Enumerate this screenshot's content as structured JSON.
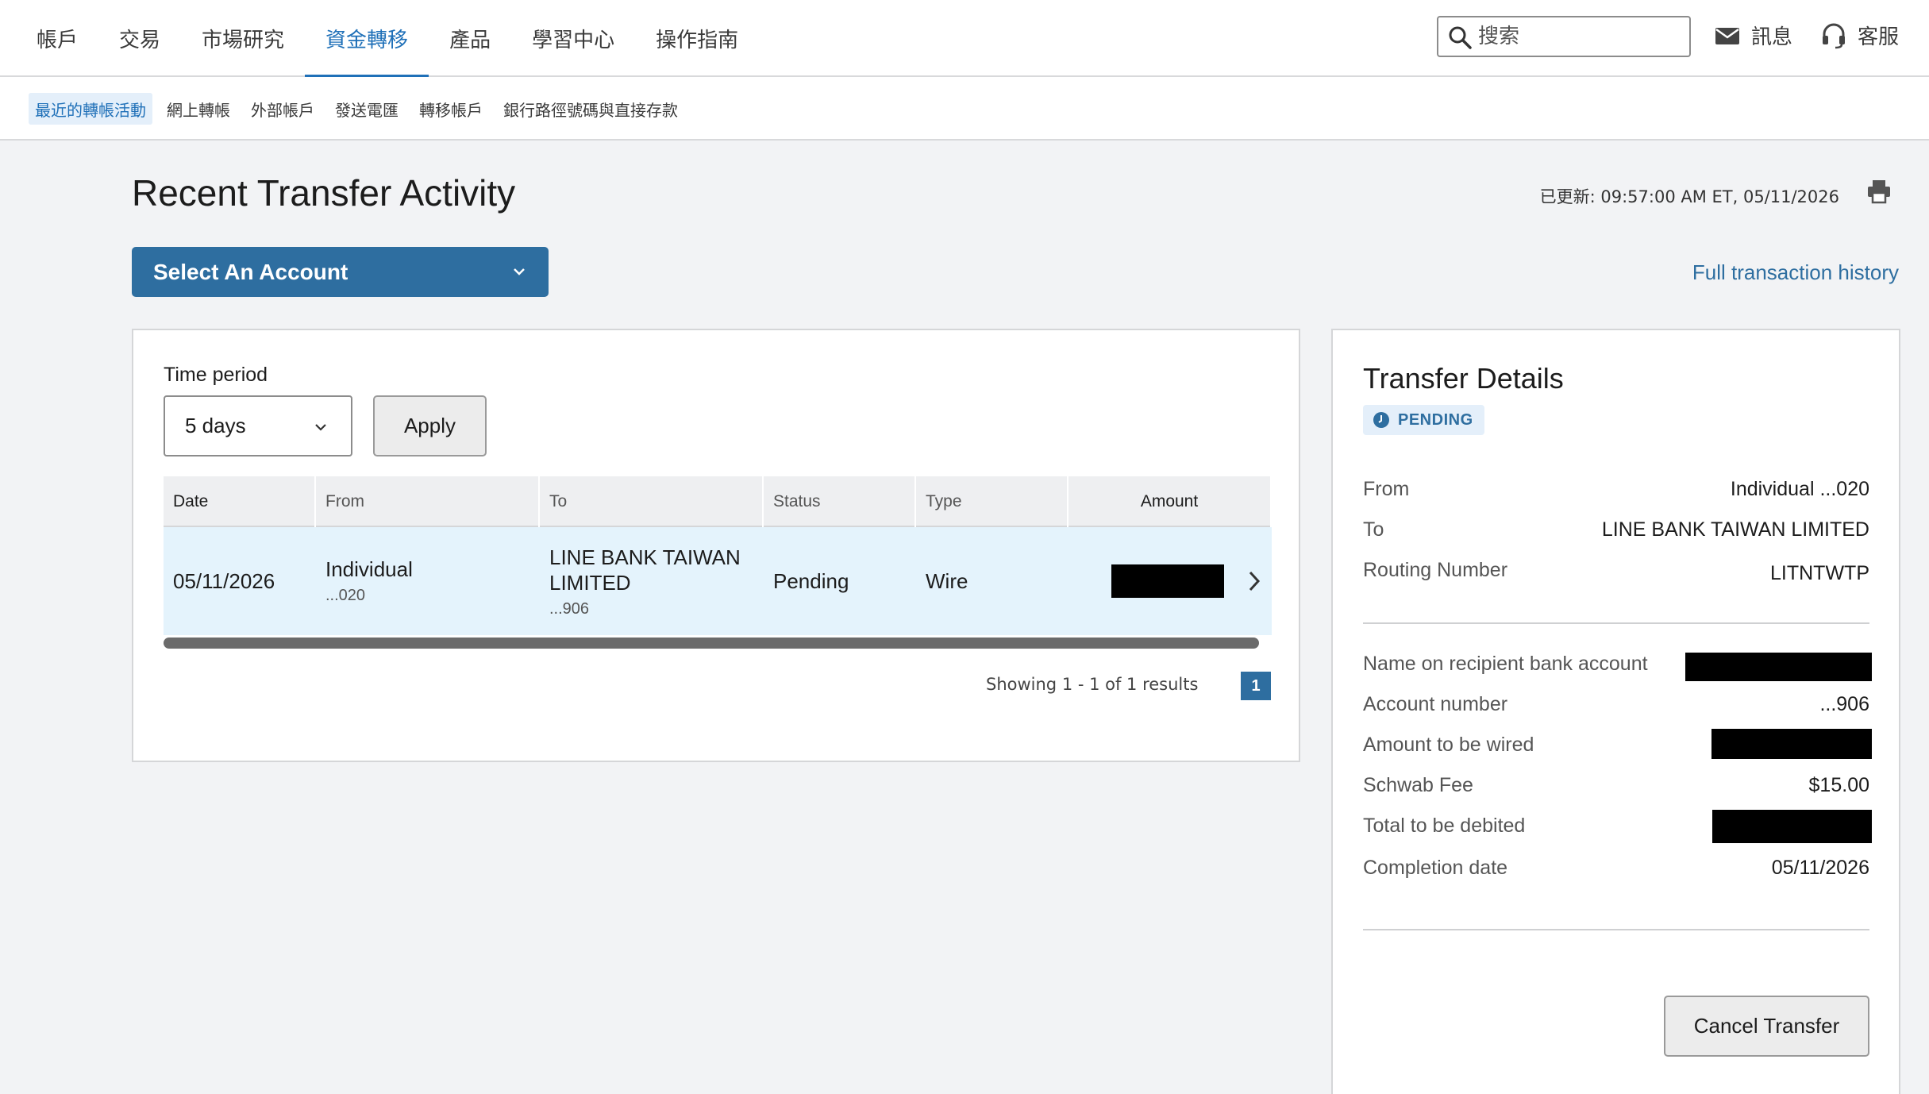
{
  "topnav": {
    "tabs": [
      "帳戶",
      "交易",
      "市場研究",
      "資金轉移",
      "產品",
      "學習中心",
      "操作指南"
    ],
    "active_tab": "資金轉移",
    "search_placeholder": "搜索",
    "messages_label": "訊息",
    "support_label": "客服"
  },
  "subnav": {
    "items": [
      "最近的轉帳活動",
      "網上轉帳",
      "外部帳戶",
      "發送電匯",
      "轉移帳戶",
      "銀行路徑號碼與直接存款"
    ],
    "active_item": "最近的轉帳活動"
  },
  "page": {
    "title": "Recent Transfer Activity",
    "updated": "已更新: 09:57:00 AM ET, 05/11/2026",
    "select_account": "Select An Account",
    "full_history": "Full transaction history"
  },
  "filter": {
    "time_period_label": "Time period",
    "time_period_value": "5 days",
    "apply_label": "Apply"
  },
  "table": {
    "headers": {
      "date": "Date",
      "from": "From",
      "to": "To",
      "status": "Status",
      "type": "Type",
      "amount": "Amount"
    },
    "rows": [
      {
        "date": "05/11/2026",
        "from": "Individual",
        "from_sub": "...020",
        "to": "LINE BANK TAIWAN LIMITED",
        "to_sub": "...906",
        "status": "Pending",
        "type": "Wire",
        "amount": "[redacted]"
      }
    ],
    "showing": "Showing 1 - 1 of 1 results",
    "page": "1"
  },
  "details": {
    "title": "Transfer Details",
    "status_badge": "PENDING",
    "from_label": "From",
    "from_value": "Individual ...020",
    "to_label": "To",
    "to_value": "LINE BANK TAIWAN LIMITED",
    "routing_label": "Routing Number",
    "routing_value": "LITNTWTP",
    "name_label": "Name on recipient bank account",
    "account_label": "Account number",
    "account_value": "...906",
    "amount_label": "Amount to be wired",
    "fee_label": "Schwab Fee",
    "fee_value": "$15.00",
    "total_label": "Total to be debited",
    "completion_label": "Completion date",
    "completion_value": "05/11/2026",
    "cancel_label": "Cancel Transfer"
  },
  "colors": {
    "accent": "#2e6ea0",
    "nav_active": "#1f70b8",
    "row_highlight": "#e4f3fc"
  }
}
